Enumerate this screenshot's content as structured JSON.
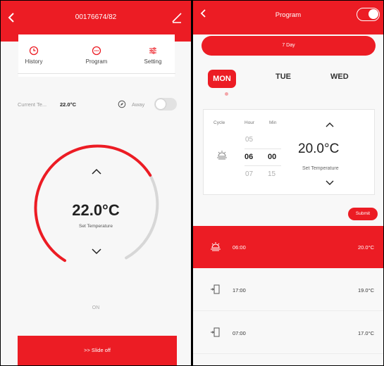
{
  "colors": {
    "accent": "#ec1c24",
    "arc_track": "#d7d7d7"
  },
  "left": {
    "header": {
      "title": "00176674/82",
      "back_icon": "chevron-left-icon",
      "edit_icon": "pencil-icon"
    },
    "tabs": [
      {
        "label": "History",
        "icon": "clock-icon"
      },
      {
        "label": "Program",
        "icon": "dots-circle-icon"
      },
      {
        "label": "Setting",
        "icon": "sliders-icon"
      }
    ],
    "current": {
      "label": "Current Te...",
      "value": "22.0°C"
    },
    "away": {
      "label": "Away",
      "enabled": false
    },
    "dial": {
      "temperature": "22.0°C",
      "subtitle": "Set Temperature"
    },
    "status": "ON",
    "slide_button": ">> Slide off"
  },
  "right": {
    "header": {
      "title": "Program",
      "enabled": true
    },
    "mode": "7 Day",
    "days": [
      "MON",
      "TUE",
      "WED"
    ],
    "selected_day": "MON",
    "picker": {
      "col_cycle": "Cycle",
      "col_hour": "Hour",
      "col_min": "Min",
      "hours": [
        "05",
        "06",
        "07"
      ],
      "minutes": [
        "00",
        "15"
      ],
      "temperature": "20.0°C",
      "subtitle": "Set Temperature"
    },
    "submit": "Submit",
    "schedule": [
      {
        "icon": "sun-icon",
        "time": "06:00",
        "temp": "20.0°C",
        "active": true
      },
      {
        "icon": "door-exit-icon",
        "time": "17:00",
        "temp": "19.0°C",
        "active": false
      },
      {
        "icon": "door-exit-icon",
        "time": "07:00",
        "temp": "17.0°C",
        "active": false
      }
    ]
  }
}
